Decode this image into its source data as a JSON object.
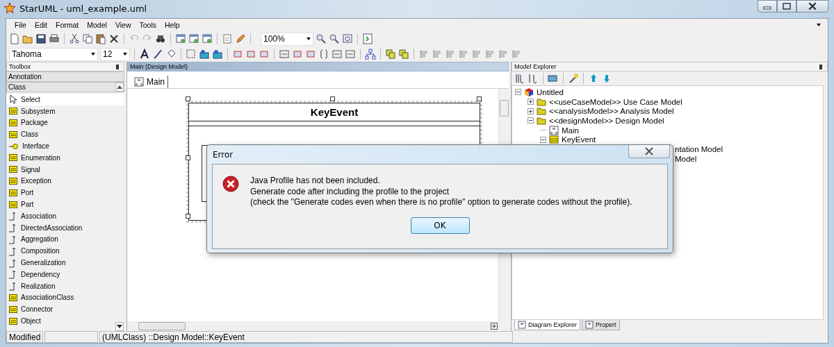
{
  "window": {
    "title": "StarUML - uml_example.uml"
  },
  "menu": [
    "File",
    "Edit",
    "Format",
    "Model",
    "View",
    "Tools",
    "Help"
  ],
  "toolbar": {
    "zoom": "100%",
    "font": "Tahoma",
    "font_size": "12"
  },
  "toolbox": {
    "title": "Toolbox",
    "groups": [
      "Annotation",
      "Class"
    ],
    "items": [
      {
        "label": "Select",
        "kind": "pointer",
        "selected": true
      },
      {
        "label": "Subsystem",
        "kind": "element",
        "selected": false
      },
      {
        "label": "Package",
        "kind": "element",
        "selected": false
      },
      {
        "label": "Class",
        "kind": "element",
        "selected": false
      },
      {
        "label": "Interface",
        "kind": "interface",
        "selected": false
      },
      {
        "label": "Enumeration",
        "kind": "element",
        "selected": false
      },
      {
        "label": "Signal",
        "kind": "element",
        "selected": false
      },
      {
        "label": "Exception",
        "kind": "element",
        "selected": false
      },
      {
        "label": "Port",
        "kind": "element",
        "selected": false
      },
      {
        "label": "Part",
        "kind": "element",
        "selected": false
      },
      {
        "label": "Association",
        "kind": "relation",
        "selected": false
      },
      {
        "label": "DirectedAssociation",
        "kind": "relation",
        "selected": false
      },
      {
        "label": "Aggregation",
        "kind": "relation",
        "selected": false
      },
      {
        "label": "Composition",
        "kind": "relation",
        "selected": false
      },
      {
        "label": "Generalization",
        "kind": "relation",
        "selected": false
      },
      {
        "label": "Dependency",
        "kind": "relation",
        "selected": false
      },
      {
        "label": "Realization",
        "kind": "relation",
        "selected": false
      },
      {
        "label": "AssociationClass",
        "kind": "element",
        "selected": false
      },
      {
        "label": "Connector",
        "kind": "element",
        "selected": false
      },
      {
        "label": "Object",
        "kind": "element",
        "selected": false
      }
    ]
  },
  "diagram": {
    "title": "Main (Design Model)",
    "tabs": [
      {
        "label": "Main",
        "selected": true
      }
    ],
    "class_name": "KeyEvent"
  },
  "model_explorer": {
    "title": "Model Explorer",
    "tree": [
      {
        "label": "Untitled",
        "kind": "project",
        "expanded": true,
        "children": [
          {
            "label": "<<useCaseModel>> Use Case Model",
            "kind": "model",
            "expanded": false
          },
          {
            "label": "<<analysisModel>> Analysis Model",
            "kind": "model",
            "expanded": false
          },
          {
            "label": "<<designModel>> Design Model",
            "kind": "model",
            "expanded": true,
            "children": [
              {
                "label": "Main",
                "kind": "diagram"
              },
              {
                "label": "KeyEvent",
                "kind": "class",
                "expanded": true
              }
            ]
          },
          {
            "label": "ntation Model",
            "kind": "partial"
          },
          {
            "label": "Model",
            "kind": "partial"
          }
        ]
      }
    ],
    "tabs": [
      {
        "label": "Diagram Explorer",
        "selected": true
      },
      {
        "label": "Propert",
        "selected": false
      }
    ]
  },
  "status_bar": {
    "state": "Modified",
    "path": "(UMLClass) ::Design Model::KeyEvent"
  },
  "dialog": {
    "title": "Error",
    "lines": [
      "Java Profile has not been included.",
      "Generate code after including the profile to the project",
      "(check the \"Generate codes even when there is no profile\" option to generate codes without the profile)."
    ],
    "button": "OK"
  }
}
